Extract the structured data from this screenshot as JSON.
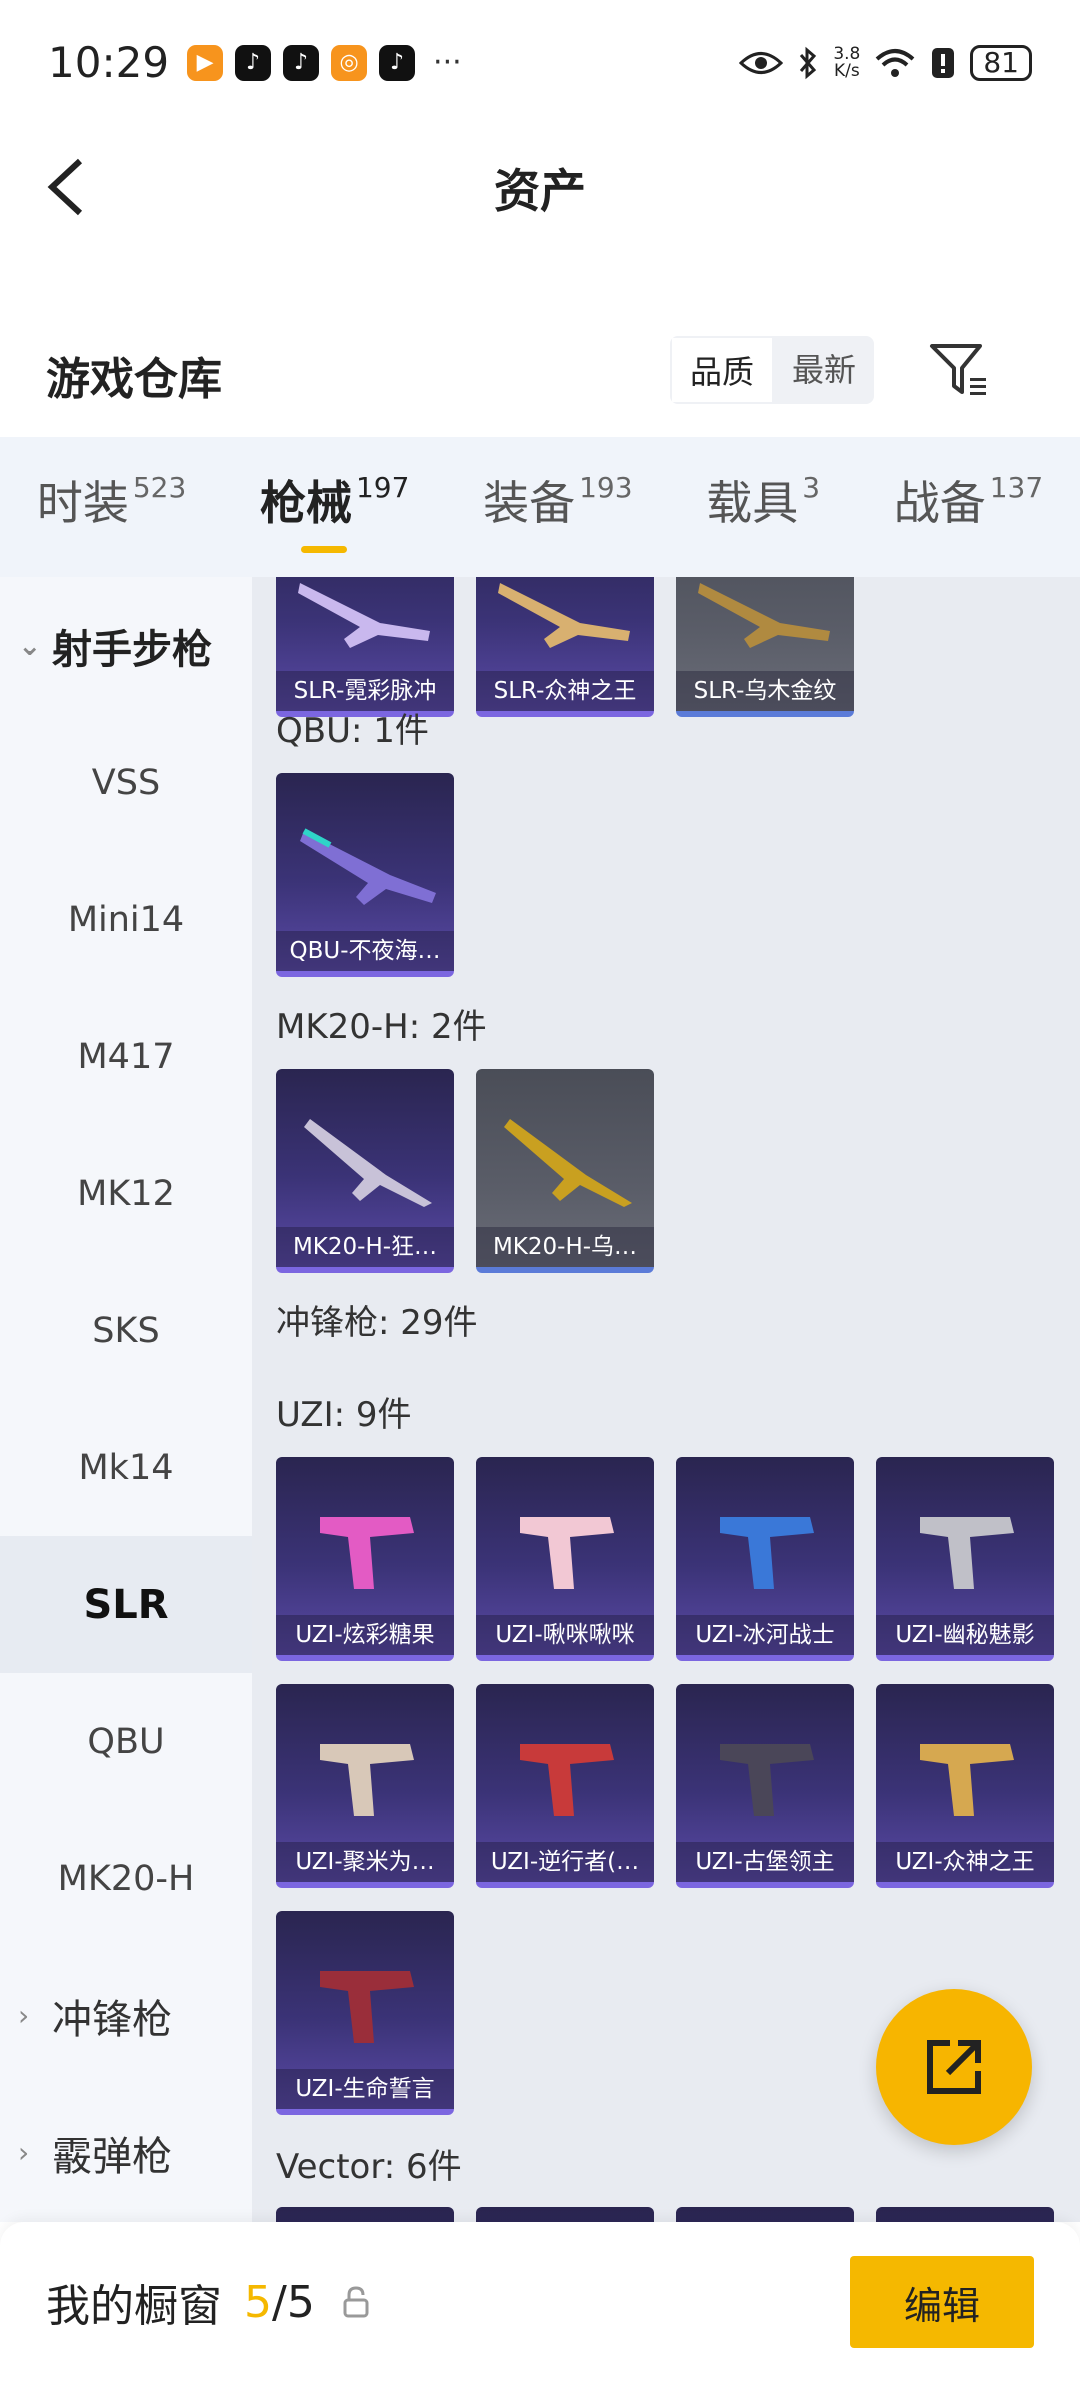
{
  "status_bar": {
    "time": "10:29",
    "net_speed_value": "3.8",
    "net_speed_unit": "K/s",
    "battery": "81"
  },
  "header": {
    "title": "资产"
  },
  "warehouse": {
    "title": "游戏仓库",
    "sort_options": [
      "品质",
      "最新"
    ],
    "active_sort": "品质"
  },
  "tabs": [
    {
      "label": "时装",
      "count": "523"
    },
    {
      "label": "枪械",
      "count": "197",
      "active": true
    },
    {
      "label": "装备",
      "count": "193"
    },
    {
      "label": "载具",
      "count": "3"
    },
    {
      "label": "战备",
      "count": "137"
    }
  ],
  "sidebar": {
    "group_open": "射手步枪",
    "items": [
      "VSS",
      "Mini14",
      "M417",
      "MK12",
      "SKS",
      "Mk14",
      "SLR",
      "QBU",
      "MK20-H"
    ],
    "selected": "SLR",
    "groups_collapsed": [
      "冲锋枪",
      "霰弹枪"
    ]
  },
  "content": {
    "slr_cards": [
      "SLR-霓彩脉冲",
      "SLR-众神之王",
      "SLR-乌木金纹"
    ],
    "qbu": {
      "label": "QBU: 1件",
      "cards": [
        "QBU-不夜海…"
      ]
    },
    "mk20h": {
      "label": "MK20-H: 2件",
      "cards": [
        "MK20-H-狂…",
        "MK20-H-乌…"
      ]
    },
    "smg_label": "冲锋枪: 29件",
    "uzi": {
      "label": "UZI: 9件",
      "cards": [
        "UZI-炫彩糖果",
        "UZI-啾咪啾咪",
        "UZI-冰河战士",
        "UZI-幽秘魅影",
        "UZI-聚米为…",
        "UZI-逆行者(…",
        "UZI-古堡领主",
        "UZI-众神之王",
        "UZI-生命誓言"
      ]
    },
    "vector": {
      "label": "Vector: 6件"
    }
  },
  "bottom_bar": {
    "title": "我的橱窗",
    "current": "5",
    "total": "/5",
    "edit_label": "编辑"
  },
  "colors": {
    "accent": "#f5b800",
    "card_purple": "#3b3377",
    "card_gray": "#5a5d68"
  }
}
